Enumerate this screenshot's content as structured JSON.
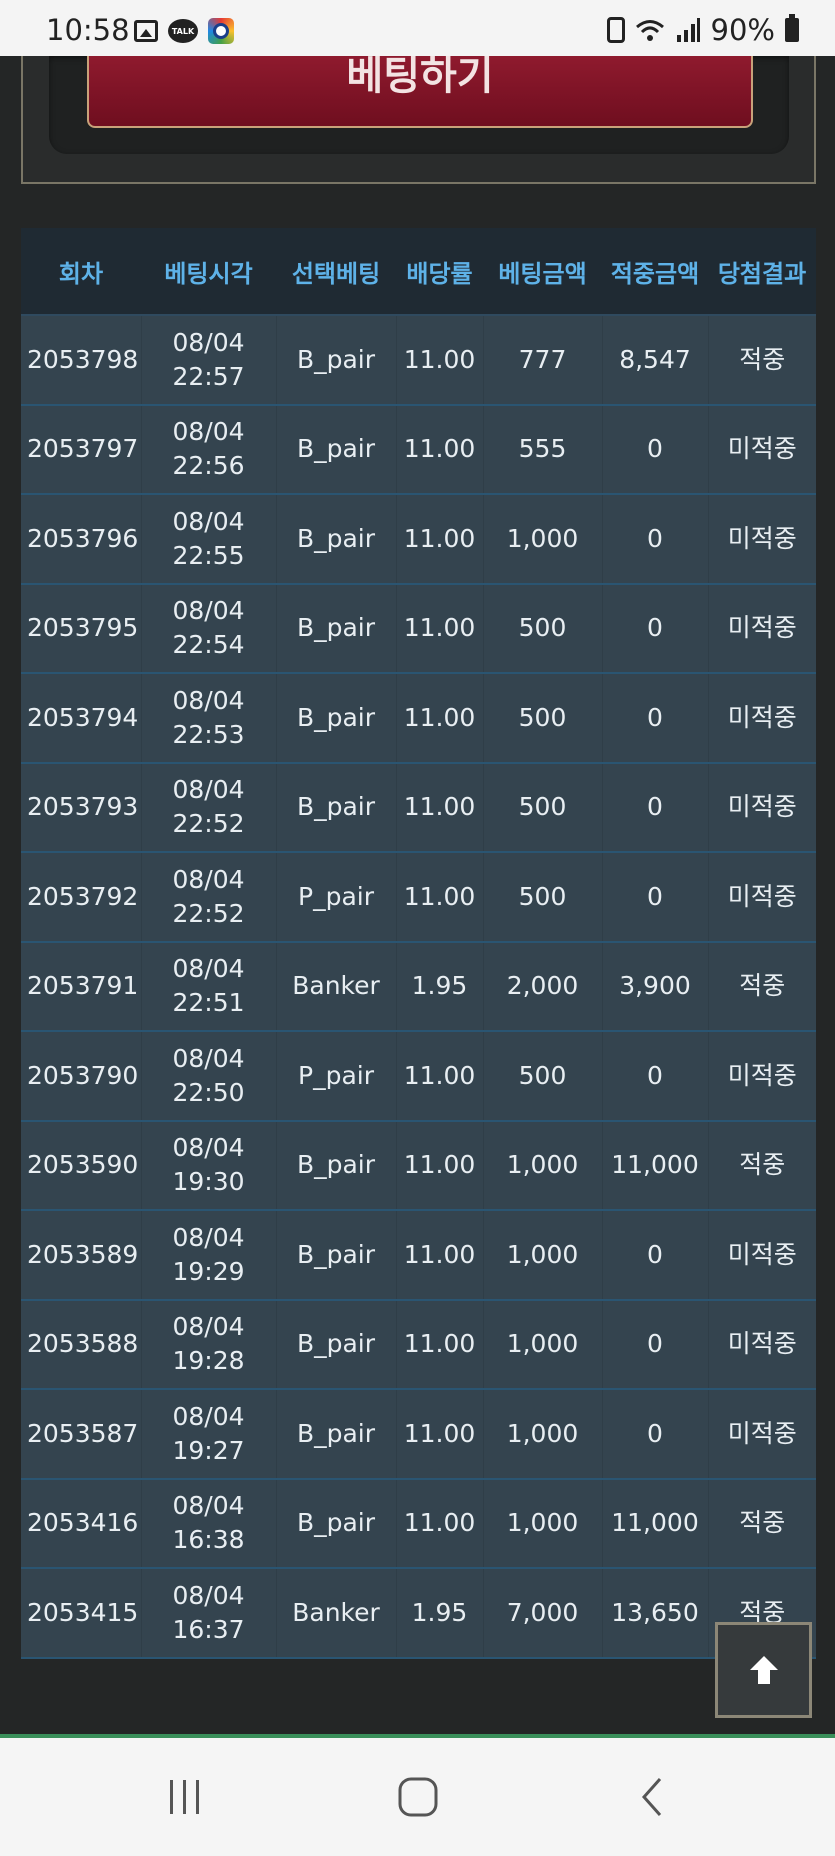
{
  "status_bar": {
    "time": "10:58",
    "talk_label": "TALK",
    "battery": "90%",
    "left_icons": [
      "photo-icon",
      "talk-icon",
      "map-icon"
    ],
    "right_icons": [
      "recycle-icon",
      "wifi-icon",
      "signal-icon",
      "battery-icon"
    ]
  },
  "bet_button": {
    "label": "베팅하기"
  },
  "table": {
    "headers": [
      "회차",
      "베팅시각",
      "선택베팅",
      "배당률",
      "베팅금액",
      "적중금액",
      "당첨결과"
    ],
    "rows": [
      {
        "round": "2053798",
        "date": "08/04",
        "time": "22:57",
        "pick": "B_pair",
        "odds": "11.00",
        "bet": "777",
        "payout": "8,547",
        "result": "적중"
      },
      {
        "round": "2053797",
        "date": "08/04",
        "time": "22:56",
        "pick": "B_pair",
        "odds": "11.00",
        "bet": "555",
        "payout": "0",
        "result": "미적중"
      },
      {
        "round": "2053796",
        "date": "08/04",
        "time": "22:55",
        "pick": "B_pair",
        "odds": "11.00",
        "bet": "1,000",
        "payout": "0",
        "result": "미적중"
      },
      {
        "round": "2053795",
        "date": "08/04",
        "time": "22:54",
        "pick": "B_pair",
        "odds": "11.00",
        "bet": "500",
        "payout": "0",
        "result": "미적중"
      },
      {
        "round": "2053794",
        "date": "08/04",
        "time": "22:53",
        "pick": "B_pair",
        "odds": "11.00",
        "bet": "500",
        "payout": "0",
        "result": "미적중"
      },
      {
        "round": "2053793",
        "date": "08/04",
        "time": "22:52",
        "pick": "B_pair",
        "odds": "11.00",
        "bet": "500",
        "payout": "0",
        "result": "미적중"
      },
      {
        "round": "2053792",
        "date": "08/04",
        "time": "22:52",
        "pick": "P_pair",
        "odds": "11.00",
        "bet": "500",
        "payout": "0",
        "result": "미적중"
      },
      {
        "round": "2053791",
        "date": "08/04",
        "time": "22:51",
        "pick": "Banker",
        "odds": "1.95",
        "bet": "2,000",
        "payout": "3,900",
        "result": "적중"
      },
      {
        "round": "2053790",
        "date": "08/04",
        "time": "22:50",
        "pick": "P_pair",
        "odds": "11.00",
        "bet": "500",
        "payout": "0",
        "result": "미적중"
      },
      {
        "round": "2053590",
        "date": "08/04",
        "time": "19:30",
        "pick": "B_pair",
        "odds": "11.00",
        "bet": "1,000",
        "payout": "11,000",
        "result": "적중"
      },
      {
        "round": "2053589",
        "date": "08/04",
        "time": "19:29",
        "pick": "B_pair",
        "odds": "11.00",
        "bet": "1,000",
        "payout": "0",
        "result": "미적중"
      },
      {
        "round": "2053588",
        "date": "08/04",
        "time": "19:28",
        "pick": "B_pair",
        "odds": "11.00",
        "bet": "1,000",
        "payout": "0",
        "result": "미적중"
      },
      {
        "round": "2053587",
        "date": "08/04",
        "time": "19:27",
        "pick": "B_pair",
        "odds": "11.00",
        "bet": "1,000",
        "payout": "0",
        "result": "미적중"
      },
      {
        "round": "2053416",
        "date": "08/04",
        "time": "16:38",
        "pick": "B_pair",
        "odds": "11.00",
        "bet": "1,000",
        "payout": "11,000",
        "result": "적중"
      },
      {
        "round": "2053415",
        "date": "08/04",
        "time": "16:37",
        "pick": "Banker",
        "odds": "1.95",
        "bet": "7,000",
        "payout": "13,650",
        "result": "적중"
      }
    ]
  },
  "scroll_top": {
    "icon": "arrow-up-icon"
  },
  "nav_bar": {
    "icons": [
      "recent-apps-icon",
      "home-icon",
      "back-icon"
    ]
  },
  "colors": {
    "hit": "#f5a623",
    "miss": "#e53935",
    "header_text": "#5eb2e8",
    "row_bg": "#34444f",
    "bet_button": "#7f1426"
  }
}
